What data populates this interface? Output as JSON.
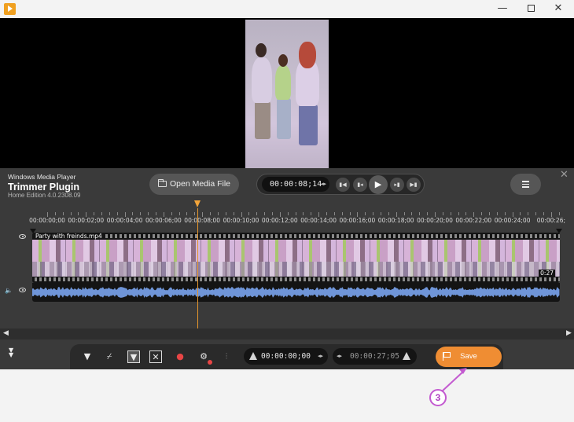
{
  "window": {
    "minimize_glyph": "—",
    "close_glyph": "✕"
  },
  "plugin": {
    "app_name": "Windows Media Player",
    "title": "Trimmer Plugin",
    "edition": "Home Edition 4.0.2308.09",
    "close_glyph": "✕"
  },
  "header": {
    "open_media_label": "Open Media File",
    "current_time": "00:00:08;14"
  },
  "timeline": {
    "tick_labels": [
      "00:00:00;00",
      "00:00:02;00",
      "00:00:04;00",
      "00:00:06;00",
      "00:00:08;00",
      "00:00:10;00",
      "00:00:12;00",
      "00:00:14;00",
      "00:00:16;00",
      "00:00:18;00",
      "00:00:20;00",
      "00:00:22;00",
      "00:00:24;00",
      "00:00:26;"
    ],
    "clip_name": "Party with freinds.mp4",
    "clip_duration": "0:27"
  },
  "toolbar": {
    "start_time": "00:00:00;00",
    "end_time": "00:00:27;05",
    "save_label": "Save"
  },
  "annotation": {
    "step_number": "3",
    "color": "#c35ad0"
  },
  "colors": {
    "accent": "#ef8d33",
    "playhead": "#e5952c",
    "waveform": "#6f95d8"
  },
  "icons": [
    "app-icon",
    "folder-icon",
    "play-icon",
    "menu-icon",
    "eye-icon",
    "speaker-icon",
    "filter-icon",
    "mic-icon",
    "settings-icon",
    "equalizer-icon",
    "hourglass-icon",
    "flag-icon"
  ]
}
